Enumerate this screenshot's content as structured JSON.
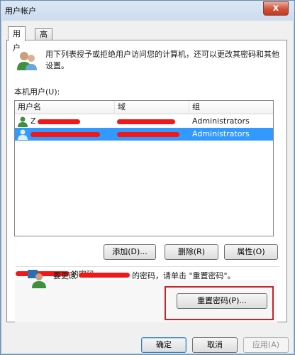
{
  "window": {
    "title": "用户帐户",
    "close_glyph": "x"
  },
  "tabs": [
    {
      "label": "用户",
      "active": true
    },
    {
      "label": "高级",
      "active": false
    }
  ],
  "intro": {
    "icon": "users-icon",
    "text": "用下列表授予或拒绝用户访问您的计算机，还可以更改其密码和其他设置。"
  },
  "users_list": {
    "caption": "本机用户(U):",
    "columns": [
      "用户名",
      "域",
      "组"
    ],
    "rows": [
      {
        "username_prefix": "Z",
        "group": "Administrators",
        "selected": false
      },
      {
        "username_prefix": "",
        "group": "Administrators",
        "selected": true
      }
    ]
  },
  "list_buttons": {
    "add": "添加(D)...",
    "remove": "删除(R)",
    "properties": "属性(O)"
  },
  "password_group": {
    "title_suffix": "的密码",
    "icon": "user-key-icon",
    "text_before": "要更改",
    "text_after": "的密码，请单击 \"重置密码\"。",
    "reset_button": "重置密码(P)..."
  },
  "dialog_buttons": {
    "ok": "确定",
    "cancel": "取消",
    "apply": "应用(A)"
  },
  "colors": {
    "selection": "#3399ff",
    "redaction": "#f01818",
    "annotation": "#c0262c"
  }
}
